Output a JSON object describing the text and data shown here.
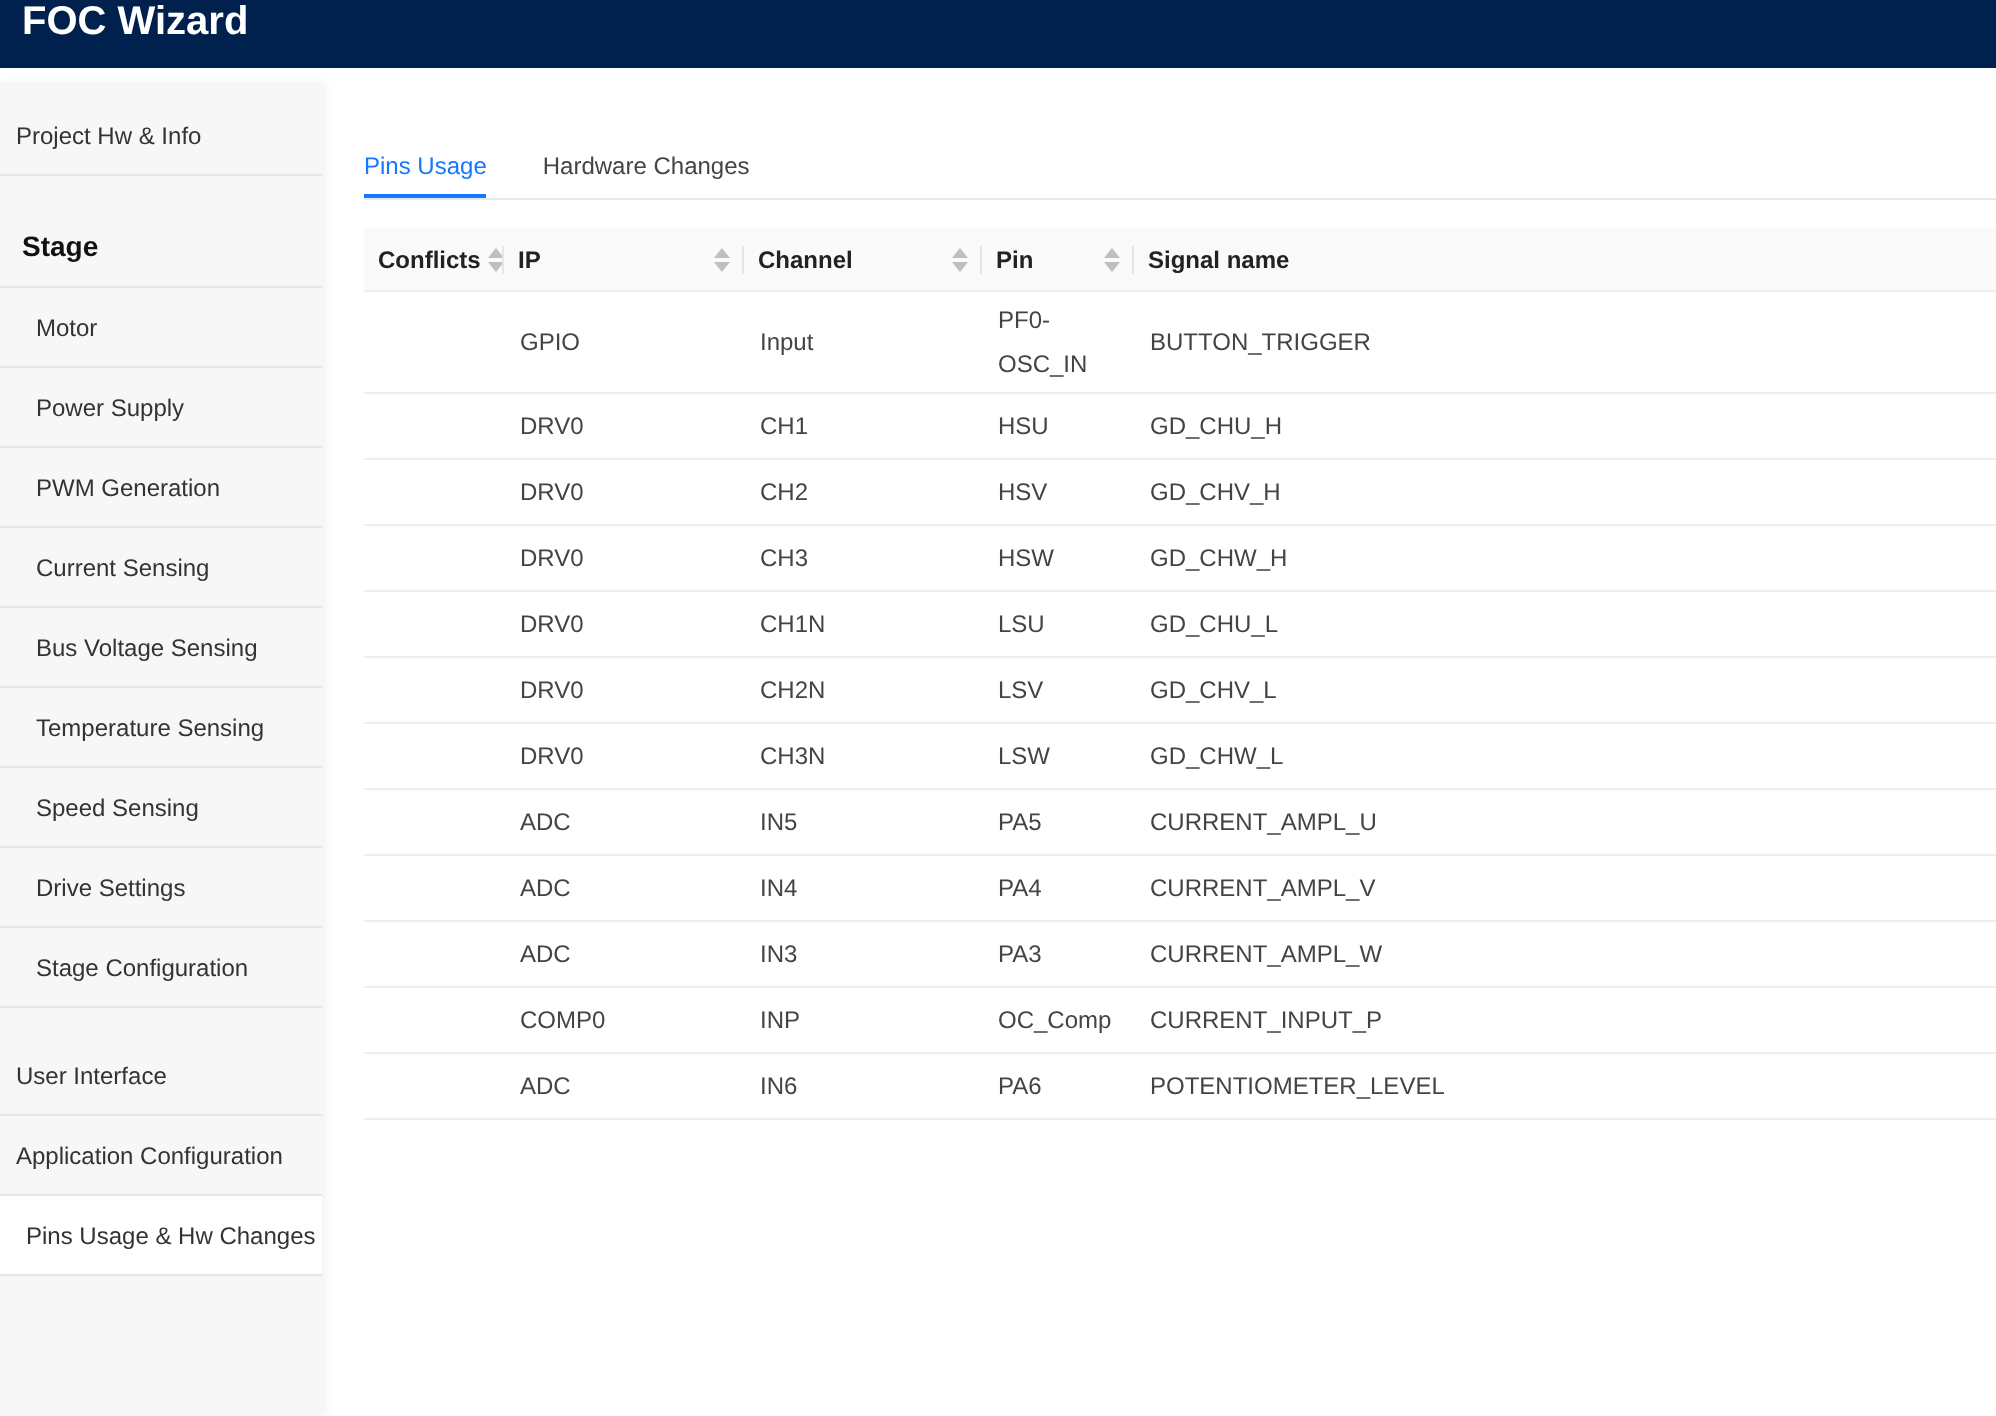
{
  "app_title": "FOC Wizard",
  "sidebar": {
    "items": [
      {
        "kind": "item",
        "label": "Project Hw & Info",
        "selected": false
      },
      {
        "kind": "heading",
        "label": "Stage",
        "children": [
          {
            "label": "Motor",
            "selected": false
          },
          {
            "label": "Power Supply",
            "selected": false
          },
          {
            "label": "PWM Generation",
            "selected": false
          },
          {
            "label": "Current Sensing",
            "selected": false
          },
          {
            "label": "Bus Voltage Sensing",
            "selected": false
          },
          {
            "label": "Temperature Sensing",
            "selected": false
          },
          {
            "label": "Speed Sensing",
            "selected": false
          },
          {
            "label": "Drive Settings",
            "selected": false
          },
          {
            "label": "Stage Configuration",
            "selected": false
          }
        ]
      },
      {
        "kind": "item",
        "label": "User Interface",
        "selected": false
      },
      {
        "kind": "item",
        "label": "Application Configuration",
        "selected": false
      },
      {
        "kind": "item",
        "label": "Pins Usage & Hw Changes",
        "selected": true
      }
    ]
  },
  "tabs": [
    {
      "label": "Pins Usage",
      "selected": true
    },
    {
      "label": "Hardware Changes",
      "selected": false
    }
  ],
  "table": {
    "columns": [
      {
        "label": "Conflicts",
        "sortable": true
      },
      {
        "label": "IP",
        "sortable": true
      },
      {
        "label": "Channel",
        "sortable": true
      },
      {
        "label": "Pin",
        "sortable": true
      },
      {
        "label": "Signal name",
        "sortable": false
      }
    ],
    "rows": [
      [
        "",
        "GPIO",
        "Input",
        "PF0-OSC_IN",
        "BUTTON_TRIGGER"
      ],
      [
        "",
        "DRV0",
        "CH1",
        "HSU",
        "GD_CHU_H"
      ],
      [
        "",
        "DRV0",
        "CH2",
        "HSV",
        "GD_CHV_H"
      ],
      [
        "",
        "DRV0",
        "CH3",
        "HSW",
        "GD_CHW_H"
      ],
      [
        "",
        "DRV0",
        "CH1N",
        "LSU",
        "GD_CHU_L"
      ],
      [
        "",
        "DRV0",
        "CH2N",
        "LSV",
        "GD_CHV_L"
      ],
      [
        "",
        "DRV0",
        "CH3N",
        "LSW",
        "GD_CHW_L"
      ],
      [
        "",
        "ADC",
        "IN5",
        "PA5",
        "CURRENT_AMPL_U"
      ],
      [
        "",
        "ADC",
        "IN4",
        "PA4",
        "CURRENT_AMPL_V"
      ],
      [
        "",
        "ADC",
        "IN3",
        "PA3",
        "CURRENT_AMPL_W"
      ],
      [
        "",
        "COMP0",
        "INP",
        "OC_Comp",
        "CURRENT_INPUT_P"
      ],
      [
        "",
        "ADC",
        "IN6",
        "PA6",
        "POTENTIOMETER_LEVEL"
      ]
    ]
  }
}
